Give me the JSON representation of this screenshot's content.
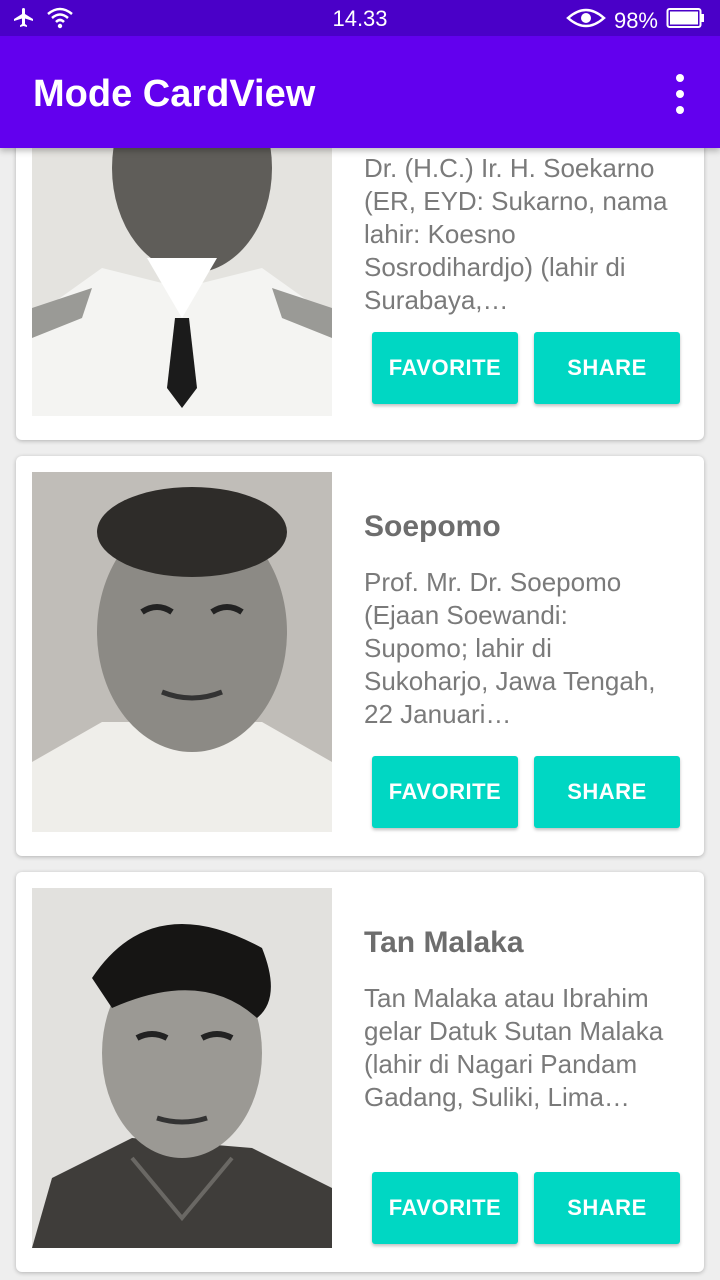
{
  "status_bar": {
    "time": "14.33",
    "battery": "98%",
    "icons": [
      "airplane-icon",
      "wifi-icon",
      "eye-icon",
      "battery-icon"
    ]
  },
  "app_bar": {
    "title": "Mode CardView",
    "menu_icon": "overflow-menu-icon"
  },
  "colors": {
    "status_bar": "#4a00c8",
    "app_bar": "#6200ee",
    "button": "#00d7c3",
    "background": "#eeeeee"
  },
  "cards": [
    {
      "name": "",
      "description": "Dr. (H.C.) Ir. H. Soekarno (ER, EYD: Sukarno, nama lahir: Koesno Sosrodihardjo) (lahir di Surabaya,…",
      "favorite_label": "FAVORITE",
      "share_label": "SHARE"
    },
    {
      "name": "Soepomo",
      "description": "Prof. Mr. Dr. Soepomo (Ejaan Soewandi: Supomo; lahir di Sukoharjo, Jawa Tengah, 22 Januari…",
      "favorite_label": "FAVORITE",
      "share_label": "SHARE"
    },
    {
      "name": "Tan Malaka",
      "description": "Tan Malaka atau Ibrahim gelar Datuk Sutan Malaka (lahir di Nagari Pandam Gadang, Suliki, Lima…",
      "favorite_label": "FAVORITE",
      "share_label": "SHARE"
    }
  ]
}
